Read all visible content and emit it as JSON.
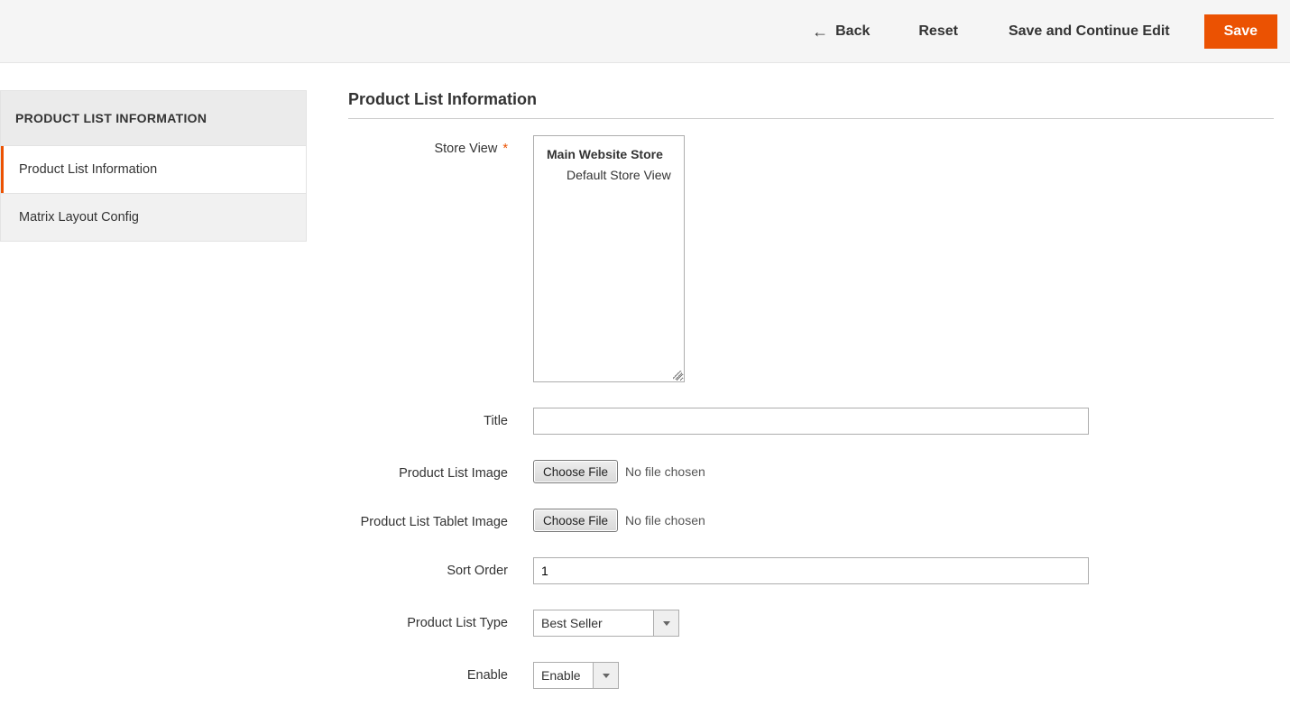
{
  "actions": {
    "back": "Back",
    "reset": "Reset",
    "save_continue": "Save and Continue Edit",
    "save": "Save"
  },
  "sidebar": {
    "title": "PRODUCT LIST INFORMATION",
    "items": [
      {
        "label": "Product List Information"
      },
      {
        "label": "Matrix Layout Config"
      }
    ]
  },
  "fieldset": {
    "title": "Product List Information",
    "store_view": {
      "label": "Store View",
      "group": "Main Website Store",
      "option": "Default Store View"
    },
    "title_field": {
      "label": "Title",
      "value": ""
    },
    "image": {
      "label": "Product List Image",
      "button": "Choose File",
      "status": "No file chosen"
    },
    "tablet_image": {
      "label": "Product List Tablet Image",
      "button": "Choose File",
      "status": "No file chosen"
    },
    "sort_order": {
      "label": "Sort Order",
      "value": "1"
    },
    "type": {
      "label": "Product List Type",
      "selected": "Best Seller"
    },
    "enable": {
      "label": "Enable",
      "selected": "Enable"
    }
  }
}
